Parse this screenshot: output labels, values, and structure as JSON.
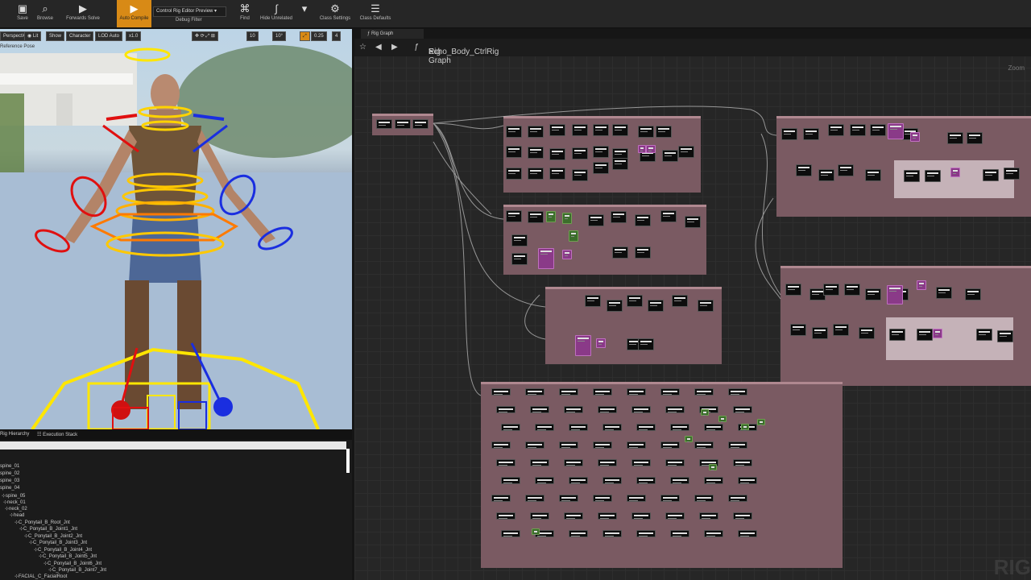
{
  "toolbar": {
    "buttons": [
      {
        "label": "Save",
        "icon": "save-icon"
      },
      {
        "label": "Browse",
        "icon": "browse-icon"
      },
      {
        "label": "Forwards Solve",
        "icon": "play-icon"
      },
      {
        "label": "Auto Compile",
        "icon": "compile-icon"
      },
      {
        "label": "Find",
        "icon": "find-icon"
      },
      {
        "label": "Hide Unrelated",
        "icon": "hide-unrelated-icon"
      },
      {
        "label": "Class Settings",
        "icon": "class-settings-icon"
      },
      {
        "label": "Class Defaults",
        "icon": "class-defaults-icon"
      }
    ],
    "preview_dropdown": "Control Rig Editor Preview",
    "debug_filter": "Debug Filter"
  },
  "viewport": {
    "view_mode": "Perspective",
    "lit": "Lit",
    "show": "Show",
    "character": "Character",
    "lod": "LOD Auto",
    "speed": "x1.0",
    "grid_value": "10",
    "rotation_value": "10°",
    "scale_value": "0.25",
    "camera_value": "4",
    "reference_label": "Reference Pose"
  },
  "lower_panel": {
    "tabs": [
      "Rig Hierarchy",
      "Execution Stack"
    ],
    "tree": [
      "spine_01",
      "spine_02",
      "spine_03",
      "spine_04",
      "spine_05",
      "neck_01",
      "neck_02",
      "head",
      "C_Ponytail_B_Root_Jnt",
      "C_Ponytail_B_Joint1_Jnt",
      "C_Ponytail_B_Joint2_Jnt",
      "C_Ponytail_B_Joint3_Jnt",
      "C_Ponytail_B_Joint4_Jnt",
      "C_Ponytail_B_Joint5_Jnt",
      "C_Ponytail_B_Joint6_Jnt",
      "C_Ponytail_B_Joint7_Jnt",
      "FACIAL_C_FacialRoot"
    ]
  },
  "graph": {
    "tab": "Rig Graph",
    "breadcrumb_asset": "Echo_Body_CtrlRig",
    "breadcrumb_sep": ">",
    "breadcrumb_graph": "Rig Graph",
    "zoom": "Zoom",
    "watermark": "RIG",
    "colors": {
      "comment_box": "#7a5a62",
      "node": "#0d0d0d",
      "pink_node": "#8a3a88",
      "green_node": "#3c6e2c"
    }
  }
}
